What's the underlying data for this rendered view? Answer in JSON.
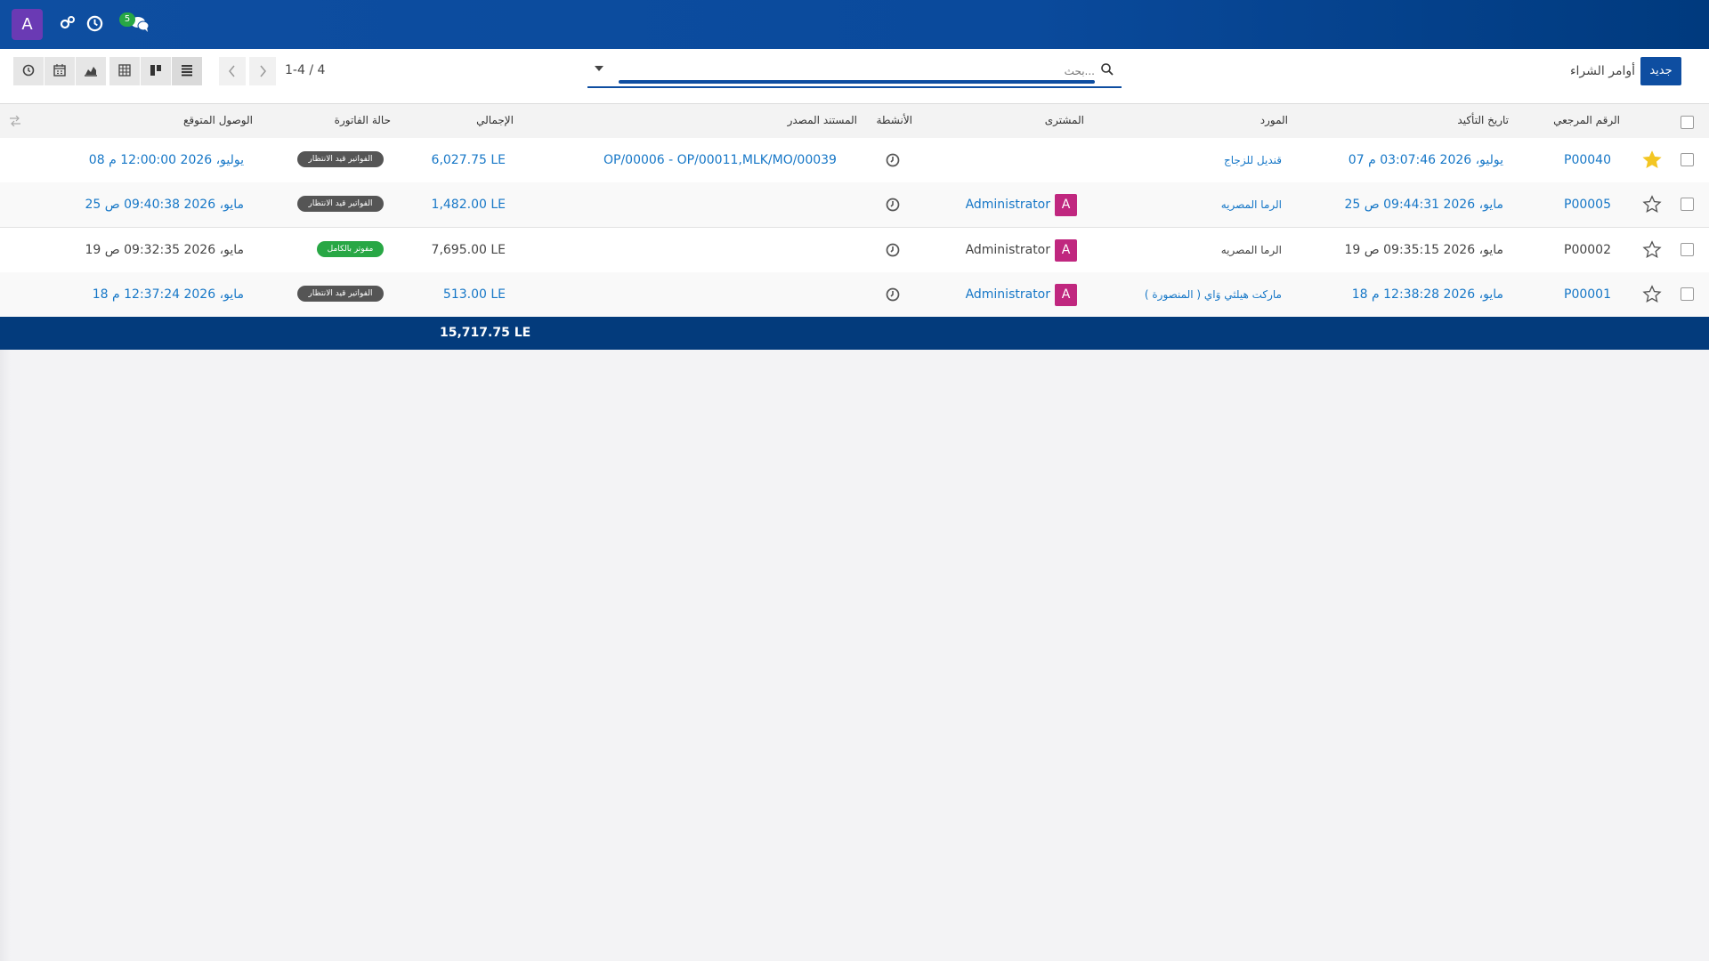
{
  "topbar": {
    "avatar_letter": "A",
    "messages_count": "5",
    "icons": [
      "settings-icon",
      "clock-icon",
      "messages-icon"
    ]
  },
  "control": {
    "new_button": "جديد",
    "breadcrumb": "أوامر الشراء",
    "search_placeholder": "بحث...",
    "pager": "1-4 / 4",
    "views": [
      "list-view-icon",
      "kanban-view-icon",
      "pivot-view-icon",
      "graph-view-icon",
      "calendar-view-icon",
      "activity-view-icon"
    ]
  },
  "table": {
    "headers": {
      "ref": "الرقم المرجعي",
      "confirm_date": "تاريخ التأكيد",
      "vendor": "المورد",
      "buyer": "المشترى",
      "activities": "الأنشطة",
      "source": "المستند المصدر",
      "total": "الإجمالي",
      "invoice_status": "حالة الفاتورة",
      "expected_arrival": "الوصول المتوقع"
    },
    "rows": [
      {
        "starred": true,
        "ref": "P00040",
        "confirm_date": "07 يوليو، 2026 03:07:46 م",
        "vendor": "قنديل للزجاج",
        "buyer": "",
        "source": "OP/00006 - OP/00011,MLK/MO/00039",
        "total": "6,027.75 LE",
        "invoice_status": "الفواتير قيد الانتظار",
        "status_color": "#555555",
        "expected_arrival": "08 يوليو، 2026 12:00:00 م",
        "linked": true
      },
      {
        "starred": false,
        "ref": "P00005",
        "confirm_date": "25 مايو، 2026 09:44:31 ص",
        "vendor": "الرما المصريه",
        "buyer": "Administrator",
        "source": "",
        "total": "1,482.00 LE",
        "invoice_status": "الفواتير قيد الانتظار",
        "status_color": "#555555",
        "expected_arrival": "25 مايو، 2026 09:40:38 ص",
        "linked": true
      },
      {
        "starred": false,
        "ref": "P00002",
        "confirm_date": "19 مايو، 2026 09:35:15 ص",
        "vendor": "الرما المصريه",
        "buyer": "Administrator",
        "source": "",
        "total": "7,695.00 LE",
        "invoice_status": "مفوتر بالكامل",
        "status_color": "#28a745",
        "expected_arrival": "19 مايو، 2026 09:32:35 ص",
        "linked": false
      },
      {
        "starred": false,
        "ref": "P00001",
        "confirm_date": "18 مايو، 2026 12:38:28 م",
        "vendor": "ماركت هيلثي وَاي ( المنصورة )",
        "buyer": "Administrator",
        "source": "",
        "total": "513.00 LE",
        "invoice_status": "الفواتير قيد الانتظار",
        "status_color": "#555555",
        "expected_arrival": "18 مايو، 2026 12:37:24 م",
        "linked": true
      }
    ],
    "buyer_avatar_letter": "A",
    "footer_total": "15,717.75 LE"
  },
  "colors": {
    "brand": "#0e4ea1",
    "footer": "#033b7c",
    "link": "#1677c7",
    "star": "#f3c623",
    "buyer_badge": "#c0277f"
  }
}
